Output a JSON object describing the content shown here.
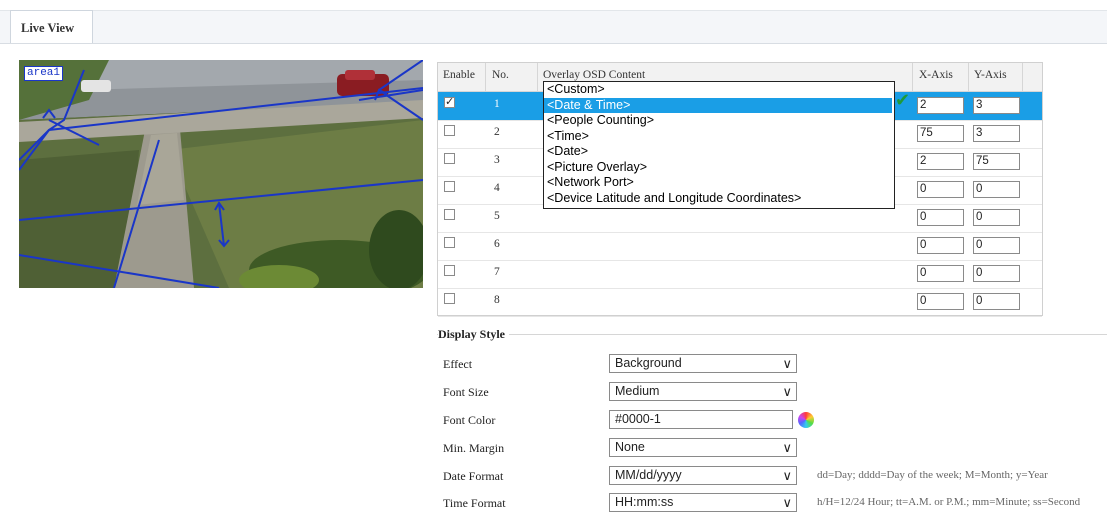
{
  "tab": {
    "label": "Live View"
  },
  "video": {
    "area_label": "area1"
  },
  "osd_table": {
    "headers": {
      "enable": "Enable",
      "no": "No.",
      "content": "Overlay OSD Content",
      "x": "X-Axis",
      "y": "Y-Axis"
    },
    "rows": [
      {
        "enabled": true,
        "no": "1",
        "x": "2",
        "y": "3"
      },
      {
        "enabled": false,
        "no": "2",
        "x": "75",
        "y": "3"
      },
      {
        "enabled": false,
        "no": "3",
        "x": "2",
        "y": "75"
      },
      {
        "enabled": false,
        "no": "4",
        "x": "0",
        "y": "0"
      },
      {
        "enabled": false,
        "no": "5",
        "x": "0",
        "y": "0"
      },
      {
        "enabled": false,
        "no": "6",
        "x": "0",
        "y": "0"
      },
      {
        "enabled": false,
        "no": "7",
        "x": "0",
        "y": "0"
      },
      {
        "enabled": false,
        "no": "8",
        "x": "0",
        "y": "0"
      }
    ],
    "dropdown_options": [
      "<Custom>",
      "<Date & Time>",
      "<People Counting>",
      "<Time>",
      "<Date>",
      "<Picture Overlay>",
      "<Network Port>",
      "<Device Latitude and Longitude Coordinates>"
    ],
    "dropdown_selected": "<Date & Time>",
    "confirm_icon": "check-icon"
  },
  "display_style": {
    "title": "Display Style",
    "effect": {
      "label": "Effect",
      "value": "Background"
    },
    "font_size": {
      "label": "Font Size",
      "value": "Medium"
    },
    "font_color": {
      "label": "Font Color",
      "value": "#0000-1"
    },
    "min_margin": {
      "label": "Min. Margin",
      "value": "None"
    },
    "date_format": {
      "label": "Date Format",
      "value": "MM/dd/yyyy",
      "hint": "dd=Day; dddd=Day of the week; M=Month; y=Year"
    },
    "time_format": {
      "label": "Time Format",
      "value": "HH:mm:ss",
      "hint": "h/H=12/24 Hour; tt=A.M. or P.M.; mm=Minute; ss=Second"
    }
  },
  "colors": {
    "selection": "#1a9ee6",
    "overlay_lines": "#1a36c8",
    "check": "#1f9a3a"
  }
}
